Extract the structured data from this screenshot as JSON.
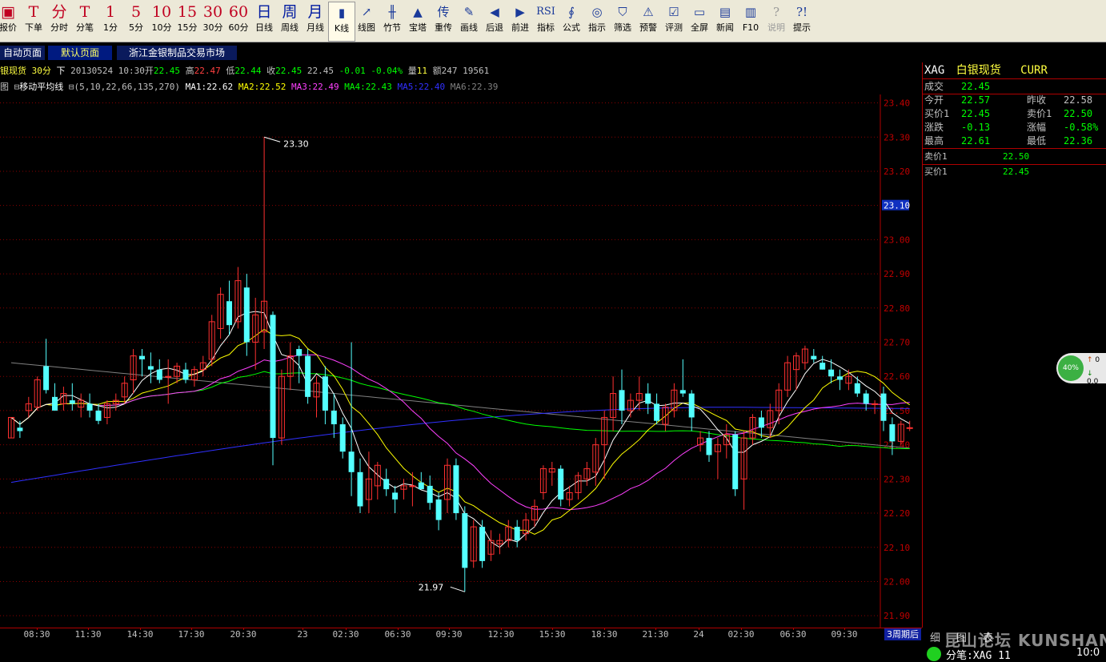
{
  "toolbar": [
    {
      "icon": "▣",
      "label": "报价",
      "name": "quote"
    },
    {
      "icon": "T",
      "label": "下单",
      "name": "order"
    },
    {
      "icon": "分",
      "label": "分时",
      "name": "timeshare"
    },
    {
      "icon": "T",
      "label": "分笔",
      "name": "ticks"
    },
    {
      "icon": "1",
      "label": "1分",
      "name": "1min"
    },
    {
      "icon": "5",
      "label": "5分",
      "name": "5min"
    },
    {
      "icon": "10",
      "label": "10分",
      "name": "10min"
    },
    {
      "icon": "15",
      "label": "15分",
      "name": "15min"
    },
    {
      "icon": "30",
      "label": "30分",
      "name": "30min"
    },
    {
      "icon": "60",
      "label": "60分",
      "name": "60min"
    },
    {
      "icon": "日",
      "label": "日线",
      "name": "daily"
    },
    {
      "icon": "周",
      "label": "周线",
      "name": "weekly"
    },
    {
      "icon": "月",
      "label": "月线",
      "name": "monthly"
    },
    {
      "icon": "▮",
      "label": "K线",
      "name": "kline"
    },
    {
      "icon": "↗",
      "label": "线图",
      "name": "linechart"
    },
    {
      "icon": "╫",
      "label": "竹节",
      "name": "bamboo"
    },
    {
      "icon": "▲",
      "label": "宝塔",
      "name": "tower"
    },
    {
      "icon": "传",
      "label": "重传",
      "name": "resend"
    },
    {
      "icon": "✎",
      "label": "画线",
      "name": "draw"
    },
    {
      "icon": "◀",
      "label": "后退",
      "name": "back"
    },
    {
      "icon": "▶",
      "label": "前进",
      "name": "forward"
    },
    {
      "icon": "RSI",
      "label": "指标",
      "name": "indicator"
    },
    {
      "icon": "∮",
      "label": "公式",
      "name": "formula"
    },
    {
      "icon": "◎",
      "label": "指示",
      "name": "hint"
    },
    {
      "icon": "⛉",
      "label": "筛选",
      "name": "filter"
    },
    {
      "icon": "⚠",
      "label": "预警",
      "name": "alert"
    },
    {
      "icon": "☑",
      "label": "评测",
      "name": "evaluate"
    },
    {
      "icon": "▭",
      "label": "全屏",
      "name": "fullscreen"
    },
    {
      "icon": "▤",
      "label": "新闻",
      "name": "news"
    },
    {
      "icon": "▥",
      "label": "F10",
      "name": "f10"
    },
    {
      "icon": "?",
      "label": "说明",
      "name": "help-doc"
    },
    {
      "icon": "?!",
      "label": "提示",
      "name": "tips"
    }
  ],
  "tabs": [
    "自动页面",
    "默认页面",
    "浙江金银制品交易市场"
  ],
  "info_line": {
    "name": "银现货",
    "period": "30分",
    "dir": "下",
    "date": "20130524",
    "time": "10:30",
    "open_label": "开",
    "open": "22.45",
    "high_label": "高",
    "high": "22.47",
    "low_label": "低",
    "low": "22.44",
    "close_label": "收",
    "close": "22.45",
    "last": "22.45",
    "chg": "-0.01",
    "pct": "-0.04%",
    "vol_label": "量",
    "vol": "11",
    "amt_label": "额",
    "amt": "247",
    "oi": "19561"
  },
  "ma_line": {
    "prefix": "图",
    "indicator": "移动平均线",
    "params": "(5,10,22,66,135,270)",
    "ma1": "MA1:22.62",
    "ma2": "MA2:22.52",
    "ma3": "MA3:22.49",
    "ma4": "MA4:22.43",
    "ma5": "MA5:22.40",
    "ma6": "MA6:22.39"
  },
  "right_panel": {
    "code": "XAG",
    "name": "白银现货",
    "currency": "CURR",
    "deal_label": "成交",
    "deal": "22.45",
    "open_label": "今开",
    "open": "22.57",
    "prev_label": "昨收",
    "prev": "22.58",
    "bid_label": "买价1",
    "bid": "22.45",
    "ask_label": "卖价1",
    "ask": "22.50",
    "chg_label": "涨跌",
    "chg": "-0.13",
    "pct_label": "涨幅",
    "pct": "-0.58%",
    "high_label": "最高",
    "high": "22.61",
    "low_label": "最低",
    "low": "22.36",
    "ask_book_label": "卖价1",
    "ask_book": "22.50",
    "bid_book_label": "买价1",
    "bid_book": "22.45"
  },
  "time_axis": [
    "08:30",
    "11:30",
    "14:30",
    "17:30",
    "20:30",
    "23",
    "02:30",
    "06:30",
    "09:30",
    "12:30",
    "15:30",
    "18:30",
    "21:30",
    "24",
    "02:30",
    "06:30",
    "09:30"
  ],
  "period_button": "3周期后",
  "bottom_tabs": [
    "细",
    "图",
    "表"
  ],
  "status_text": "分笔:XAG 11",
  "clock": "10:0",
  "watermark": "昆山论坛 KUNSHAN BBS",
  "badge": {
    "pct": "40%",
    "up": "0",
    "down": "0.0"
  },
  "colors": {
    "up": "#ff3030",
    "down": "#54ffff",
    "ma1": "#ffffff",
    "ma2": "#ffff00",
    "ma3": "#ff40ff",
    "ma4": "#00ff00",
    "ma5": "#3030ff",
    "ma6": "#808080"
  },
  "chart_data": {
    "type": "candlestick",
    "y_ticks": [
      "23.40",
      "23.30",
      "23.20",
      "23.10",
      "23.00",
      "22.90",
      "22.80",
      "22.70",
      "22.60",
      "22.50",
      "22.40",
      "22.30",
      "22.20",
      "22.10",
      "22.00",
      "21.90"
    ],
    "ylim": [
      21.87,
      23.42
    ],
    "current_price": "23.10",
    "annotations": [
      {
        "label": "23.30",
        "value": 23.3
      },
      {
        "label": "21.97",
        "value": 21.97
      }
    ],
    "candles": [
      [
        22.42,
        22.48,
        22.42,
        22.48
      ],
      [
        22.45,
        22.47,
        22.42,
        22.44
      ],
      [
        22.5,
        22.54,
        22.48,
        22.52
      ],
      [
        22.51,
        22.6,
        22.5,
        22.59
      ],
      [
        22.63,
        22.71,
        22.55,
        22.56
      ],
      [
        22.54,
        22.58,
        22.5,
        22.5
      ],
      [
        22.52,
        22.57,
        22.5,
        22.55
      ],
      [
        22.53,
        22.58,
        22.5,
        22.52
      ],
      [
        22.51,
        22.55,
        22.48,
        22.53
      ],
      [
        22.52,
        22.55,
        22.48,
        22.5
      ],
      [
        22.5,
        22.52,
        22.46,
        22.47
      ],
      [
        22.48,
        22.53,
        22.46,
        22.52
      ],
      [
        22.52,
        22.55,
        22.5,
        22.53
      ],
      [
        22.54,
        22.6,
        22.52,
        22.58
      ],
      [
        22.59,
        22.68,
        22.55,
        22.66
      ],
      [
        22.66,
        22.68,
        22.6,
        22.65
      ],
      [
        22.63,
        22.67,
        22.58,
        22.62
      ],
      [
        22.62,
        22.65,
        22.58,
        22.59
      ],
      [
        22.6,
        22.65,
        22.52,
        22.6
      ],
      [
        22.6,
        22.64,
        22.58,
        22.63
      ],
      [
        22.62,
        22.64,
        22.58,
        22.59
      ],
      [
        22.59,
        22.63,
        22.57,
        22.62
      ],
      [
        22.62,
        22.66,
        22.6,
        22.64
      ],
      [
        22.65,
        22.78,
        22.63,
        22.76
      ],
      [
        22.74,
        22.86,
        22.71,
        22.84
      ],
      [
        22.82,
        22.88,
        22.72,
        22.75
      ],
      [
        22.76,
        22.92,
        22.74,
        22.88
      ],
      [
        22.86,
        22.9,
        22.66,
        22.7
      ],
      [
        22.7,
        22.83,
        22.62,
        22.78
      ],
      [
        22.73,
        23.3,
        22.68,
        22.82
      ],
      [
        22.78,
        22.79,
        22.34,
        22.42
      ],
      [
        22.42,
        22.62,
        22.4,
        22.6
      ],
      [
        22.6,
        22.7,
        22.56,
        22.66
      ],
      [
        22.68,
        22.69,
        22.58,
        22.66
      ],
      [
        22.66,
        22.68,
        22.52,
        22.54
      ],
      [
        22.54,
        22.6,
        22.48,
        22.58
      ],
      [
        22.6,
        22.63,
        22.46,
        22.5
      ],
      [
        22.5,
        22.55,
        22.42,
        22.46
      ],
      [
        22.46,
        22.48,
        22.36,
        22.38
      ],
      [
        22.38,
        22.7,
        22.25,
        22.32
      ],
      [
        22.32,
        22.36,
        22.2,
        22.22
      ],
      [
        22.24,
        22.38,
        22.2,
        22.3
      ],
      [
        22.28,
        22.35,
        22.24,
        22.34
      ],
      [
        22.3,
        22.33,
        22.25,
        22.27
      ],
      [
        22.26,
        22.28,
        22.2,
        22.24
      ],
      [
        22.27,
        22.3,
        22.24,
        22.28
      ],
      [
        22.28,
        22.32,
        22.22,
        22.28
      ],
      [
        22.29,
        22.32,
        22.27,
        22.27
      ],
      [
        22.28,
        22.31,
        22.21,
        22.23
      ],
      [
        22.24,
        22.26,
        22.15,
        22.18
      ],
      [
        22.24,
        22.36,
        22.2,
        22.34
      ],
      [
        22.34,
        22.36,
        22.18,
        22.2
      ],
      [
        22.2,
        22.22,
        21.97,
        22.04
      ],
      [
        22.06,
        22.18,
        22.04,
        22.16
      ],
      [
        22.16,
        22.18,
        22.04,
        22.06
      ],
      [
        22.08,
        22.15,
        22.06,
        22.12
      ],
      [
        22.11,
        22.14,
        22.08,
        22.12
      ],
      [
        22.12,
        22.18,
        22.1,
        22.16
      ],
      [
        22.16,
        22.18,
        22.1,
        22.12
      ],
      [
        22.14,
        22.2,
        22.12,
        22.18
      ],
      [
        22.18,
        22.24,
        22.16,
        22.22
      ],
      [
        22.26,
        22.34,
        22.24,
        22.33
      ],
      [
        22.32,
        22.35,
        22.28,
        22.33
      ],
      [
        22.33,
        22.34,
        22.22,
        22.24
      ],
      [
        22.24,
        22.28,
        22.22,
        22.26
      ],
      [
        22.26,
        22.32,
        22.24,
        22.31
      ],
      [
        22.3,
        22.35,
        22.28,
        22.33
      ],
      [
        22.32,
        22.42,
        22.28,
        22.4
      ],
      [
        22.4,
        22.5,
        22.3,
        22.48
      ],
      [
        22.48,
        22.6,
        22.44,
        22.55
      ],
      [
        22.56,
        22.62,
        22.46,
        22.5
      ],
      [
        22.5,
        22.55,
        22.48,
        22.53
      ],
      [
        22.53,
        22.6,
        22.5,
        22.55
      ],
      [
        22.55,
        22.58,
        22.49,
        22.52
      ],
      [
        22.52,
        22.55,
        22.46,
        22.47
      ],
      [
        22.46,
        22.52,
        22.44,
        22.51
      ],
      [
        22.5,
        22.58,
        22.48,
        22.56
      ],
      [
        22.56,
        22.65,
        22.54,
        22.55
      ],
      [
        22.55,
        22.56,
        22.44,
        22.48
      ],
      [
        22.4,
        22.44,
        22.38,
        22.42
      ],
      [
        22.42,
        22.44,
        22.35,
        22.37
      ],
      [
        22.38,
        22.42,
        22.3,
        22.4
      ],
      [
        22.4,
        22.46,
        22.36,
        22.43
      ],
      [
        22.43,
        22.44,
        22.25,
        22.27
      ],
      [
        22.3,
        22.44,
        22.21,
        22.42
      ],
      [
        22.42,
        22.49,
        22.4,
        22.48
      ],
      [
        22.48,
        22.5,
        22.42,
        22.45
      ],
      [
        22.45,
        22.52,
        22.42,
        22.5
      ],
      [
        22.5,
        22.58,
        22.46,
        22.56
      ],
      [
        22.56,
        22.66,
        22.54,
        22.64
      ],
      [
        22.62,
        22.67,
        22.56,
        22.66
      ],
      [
        22.64,
        22.69,
        22.62,
        22.68
      ],
      [
        22.66,
        22.68,
        22.64,
        22.65
      ],
      [
        22.64,
        22.66,
        22.62,
        22.62
      ],
      [
        22.62,
        22.65,
        22.58,
        22.6
      ],
      [
        22.6,
        22.62,
        22.56,
        22.59
      ],
      [
        22.58,
        22.62,
        22.56,
        22.6
      ],
      [
        22.58,
        22.6,
        22.54,
        22.55
      ],
      [
        22.55,
        22.56,
        22.5,
        22.52
      ],
      [
        22.52,
        22.53,
        22.49,
        22.52
      ],
      [
        22.55,
        22.57,
        22.44,
        22.47
      ],
      [
        22.46,
        22.48,
        22.37,
        22.41
      ],
      [
        22.41,
        22.47,
        22.4,
        22.46
      ],
      [
        22.45,
        22.47,
        22.44,
        22.45
      ]
    ]
  }
}
